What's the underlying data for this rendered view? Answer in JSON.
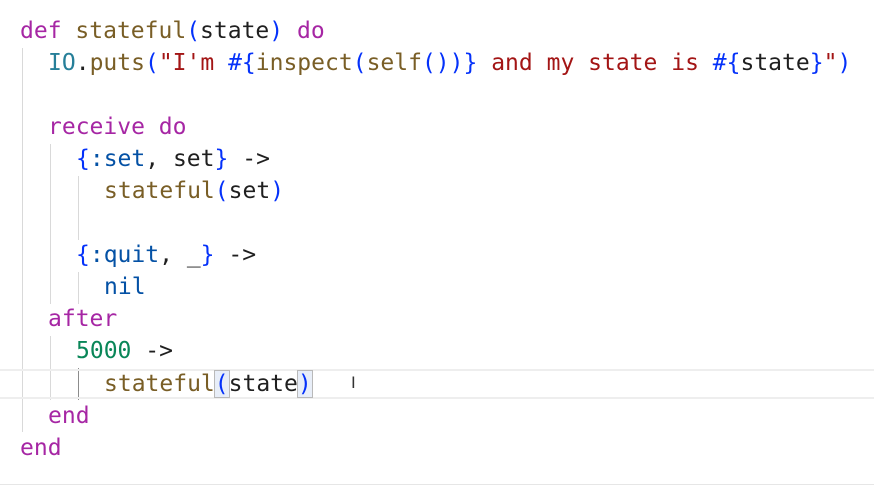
{
  "code": {
    "l1": {
      "kw_def": "def",
      "fn": "stateful",
      "open": "(",
      "arg": "state",
      "close": ")",
      "kw_do": "do"
    },
    "l2": {
      "mod": "IO",
      "dot": ".",
      "fn": "puts",
      "open": "(",
      "str_a": "\"I'm ",
      "interp_a": "#{",
      "fn_inspect": "inspect",
      "p1": "(",
      "fn_self": "self",
      "p2": "())",
      "interp_a_close": "}",
      "str_b": " and my state is ",
      "interp_b": "#{",
      "var": "state",
      "interp_b_close": "}",
      "str_c": "\"",
      "close": ")"
    },
    "l3": {
      "kw_receive": "receive",
      "kw_do": "do"
    },
    "l4": {
      "brace_open": "{",
      "atom": ":set",
      "comma": ", ",
      "var": "set",
      "brace_close": "}",
      "arrow": "->"
    },
    "l5": {
      "fn": "stateful",
      "open": "(",
      "arg": "set",
      "close": ")"
    },
    "l6": {
      "brace_open": "{",
      "atom": ":quit",
      "comma": ", ",
      "var": "_",
      "brace_close": "}",
      "arrow": "->"
    },
    "l7": {
      "nil": "nil"
    },
    "l8": {
      "kw_after": "after"
    },
    "l9": {
      "num": "5000",
      "arrow": "->"
    },
    "l10": {
      "fn": "stateful",
      "open": "(",
      "arg": "state",
      "close": ")"
    },
    "l11": {
      "kw_end": "end"
    },
    "l12": {
      "kw_end": "end"
    }
  },
  "colors": {
    "keyword": "#a626a4",
    "function": "#795e26",
    "module": "#267f99",
    "string": "#a31515",
    "interpolation": "#0431fa",
    "atom": "#0451a5",
    "number": "#098658"
  },
  "icons": {
    "cursor": "text-cursor-icon"
  }
}
